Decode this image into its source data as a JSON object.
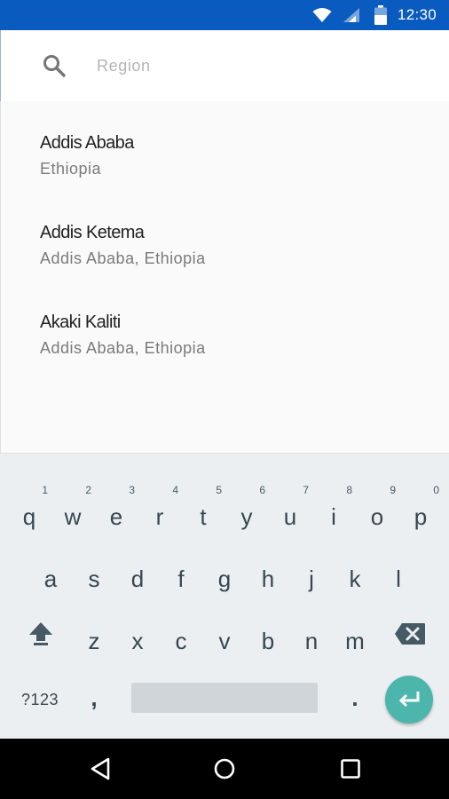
{
  "status_bar": {
    "time": "12:30",
    "icons": [
      "wifi-icon",
      "signal-icon",
      "battery-icon"
    ],
    "background": "#0a5bbf"
  },
  "search": {
    "placeholder": "Region",
    "value": "",
    "icon": "search-icon"
  },
  "results": [
    {
      "name": "Addis Ababa",
      "sub": "Ethiopia"
    },
    {
      "name": "Addis Ketema",
      "sub": "Addis Ababa, Ethiopia"
    },
    {
      "name": "Akaki Kaliti",
      "sub": "Addis Ababa, Ethiopia"
    }
  ],
  "keyboard": {
    "row1": [
      {
        "key": "q",
        "hint": "1"
      },
      {
        "key": "w",
        "hint": "2"
      },
      {
        "key": "e",
        "hint": "3"
      },
      {
        "key": "r",
        "hint": "4"
      },
      {
        "key": "t",
        "hint": "5"
      },
      {
        "key": "y",
        "hint": "6"
      },
      {
        "key": "u",
        "hint": "7"
      },
      {
        "key": "i",
        "hint": "8"
      },
      {
        "key": "o",
        "hint": "9"
      },
      {
        "key": "p",
        "hint": "0"
      }
    ],
    "row2": [
      "a",
      "s",
      "d",
      "f",
      "g",
      "h",
      "j",
      "k",
      "l"
    ],
    "row3": [
      "z",
      "x",
      "c",
      "v",
      "b",
      "n",
      "m"
    ],
    "symbols_label": "?123",
    "comma": ",",
    "period": ".",
    "icons": [
      "shift-icon",
      "backspace-icon",
      "enter-icon"
    ],
    "enter_color": "#4db6ac"
  },
  "nav_bar": {
    "icons": [
      "back-icon",
      "home-icon",
      "recents-icon"
    ]
  }
}
